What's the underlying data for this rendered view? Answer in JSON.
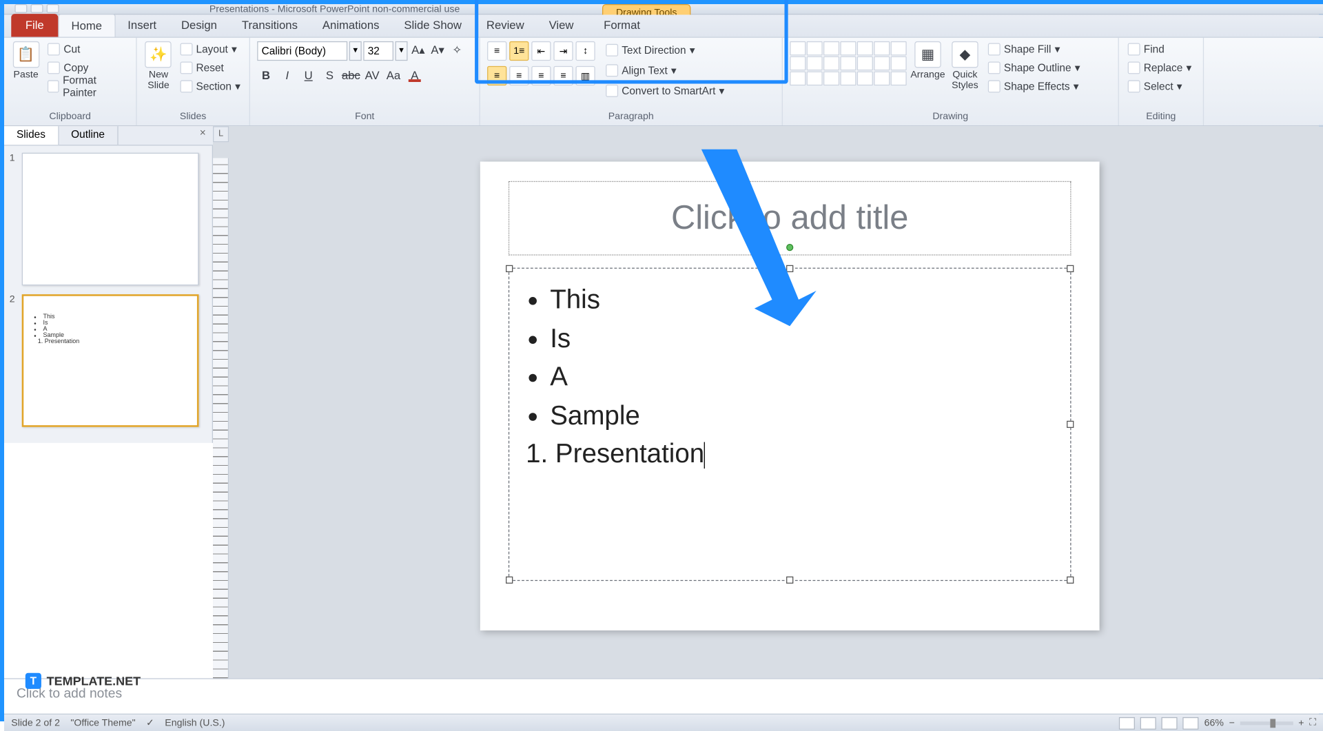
{
  "window": {
    "title": "Presentations - Microsoft PowerPoint non-commercial use",
    "context_tab_header": "Drawing Tools"
  },
  "ribbon_tabs": {
    "file": "File",
    "home": "Home",
    "insert": "Insert",
    "design": "Design",
    "transitions": "Transitions",
    "animations": "Animations",
    "slideshow": "Slide Show",
    "review": "Review",
    "view": "View",
    "format": "Format"
  },
  "clipboard": {
    "paste": "Paste",
    "cut": "Cut",
    "copy": "Copy",
    "format_painter": "Format Painter",
    "label": "Clipboard"
  },
  "slides_group": {
    "new_slide": "New\nSlide",
    "layout": "Layout",
    "reset": "Reset",
    "section": "Section",
    "label": "Slides"
  },
  "font_group": {
    "font_name": "Calibri (Body)",
    "font_size": "32",
    "label": "Font"
  },
  "paragraph_group": {
    "text_direction": "Text Direction",
    "align_text": "Align Text",
    "convert_smartart": "Convert to SmartArt",
    "label": "Paragraph"
  },
  "drawing_group": {
    "arrange": "Arrange",
    "quick_styles": "Quick\nStyles",
    "shape_fill": "Shape Fill",
    "shape_outline": "Shape Outline",
    "shape_effects": "Shape Effects",
    "label": "Drawing"
  },
  "editing_group": {
    "find": "Find",
    "replace": "Replace",
    "select": "Select",
    "label": "Editing"
  },
  "panes": {
    "slides_tab": "Slides",
    "outline_tab": "Outline"
  },
  "thumbnails": {
    "s1": "1",
    "s2": "2",
    "s2_items": {
      "a": "This",
      "b": "Is",
      "c": "A",
      "d": "Sample",
      "e": "Presentation"
    }
  },
  "slide": {
    "title_placeholder": "Click to add title",
    "content": {
      "l1": "This",
      "l2": "Is",
      "l3": "A",
      "l4": "Sample",
      "l5": "Presentation"
    }
  },
  "notes": {
    "placeholder": "Click to add notes"
  },
  "status": {
    "slide_of": "Slide 2 of 2",
    "theme": "\"Office Theme\"",
    "lang": "English (U.S.)",
    "zoom": "66%"
  },
  "watermark": {
    "text": "TEMPLATE.NET"
  }
}
